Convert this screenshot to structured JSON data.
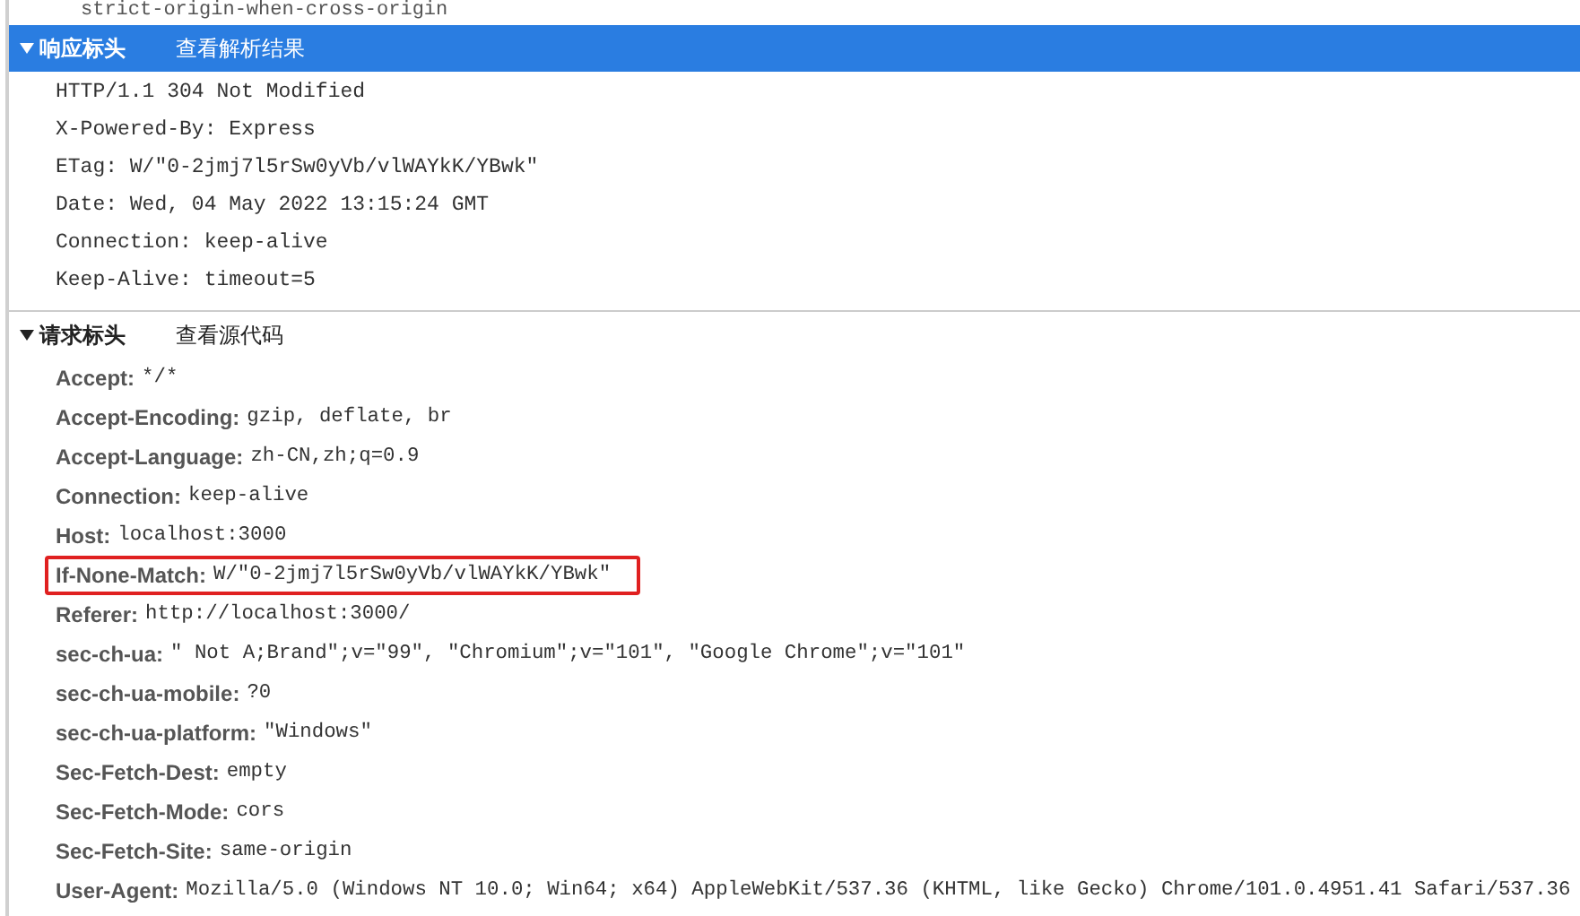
{
  "cut_off_line": "strict-origin-when-cross-origin",
  "sections": [
    {
      "title": "响应标头",
      "action": "查看解析结果",
      "selected": true,
      "expanded": true,
      "kind": "raw",
      "lines": [
        {
          "text": "HTTP/1.1 304 Not Modified",
          "highlighted": false
        },
        {
          "text": "X-Powered-By: Express",
          "highlighted": false
        },
        {
          "text": "ETag: W/\"0-2jmj7l5rSw0yVb/vlWAYkK/YBwk\"",
          "highlighted": false
        },
        {
          "text": "Date: Wed, 04 May 2022 13:15:24 GMT",
          "highlighted": false
        },
        {
          "text": "Connection: keep-alive",
          "highlighted": false
        },
        {
          "text": "Keep-Alive: timeout=5",
          "highlighted": false
        }
      ]
    },
    {
      "title": "请求标头",
      "action": "查看源代码",
      "selected": false,
      "expanded": true,
      "kind": "parsed",
      "lines": [
        {
          "name": "Accept:",
          "value": "*/*",
          "highlighted": false
        },
        {
          "name": "Accept-Encoding:",
          "value": "gzip, deflate, br",
          "highlighted": false
        },
        {
          "name": "Accept-Language:",
          "value": "zh-CN,zh;q=0.9",
          "highlighted": false
        },
        {
          "name": "Connection:",
          "value": "keep-alive",
          "highlighted": false
        },
        {
          "name": "Host:",
          "value": "localhost:3000",
          "highlighted": false
        },
        {
          "name": "If-None-Match:",
          "value": "W/\"0-2jmj7l5rSw0yVb/vlWAYkK/YBwk\"",
          "highlighted": true
        },
        {
          "name": "Referer:",
          "value": "http://localhost:3000/",
          "highlighted": false
        },
        {
          "name": "sec-ch-ua:",
          "value": "\" Not A;Brand\";v=\"99\", \"Chromium\";v=\"101\", \"Google Chrome\";v=\"101\"",
          "highlighted": false
        },
        {
          "name": "sec-ch-ua-mobile:",
          "value": "?0",
          "highlighted": false
        },
        {
          "name": "sec-ch-ua-platform:",
          "value": "\"Windows\"",
          "highlighted": false
        },
        {
          "name": "Sec-Fetch-Dest:",
          "value": "empty",
          "highlighted": false
        },
        {
          "name": "Sec-Fetch-Mode:",
          "value": "cors",
          "highlighted": false
        },
        {
          "name": "Sec-Fetch-Site:",
          "value": "same-origin",
          "highlighted": false
        },
        {
          "name": "User-Agent:",
          "value": "Mozilla/5.0 (Windows NT 10.0; Win64; x64) AppleWebKit/537.36 (KHTML, like Gecko) Chrome/101.0.4951.41 Safari/537.36",
          "highlighted": false
        }
      ]
    }
  ]
}
